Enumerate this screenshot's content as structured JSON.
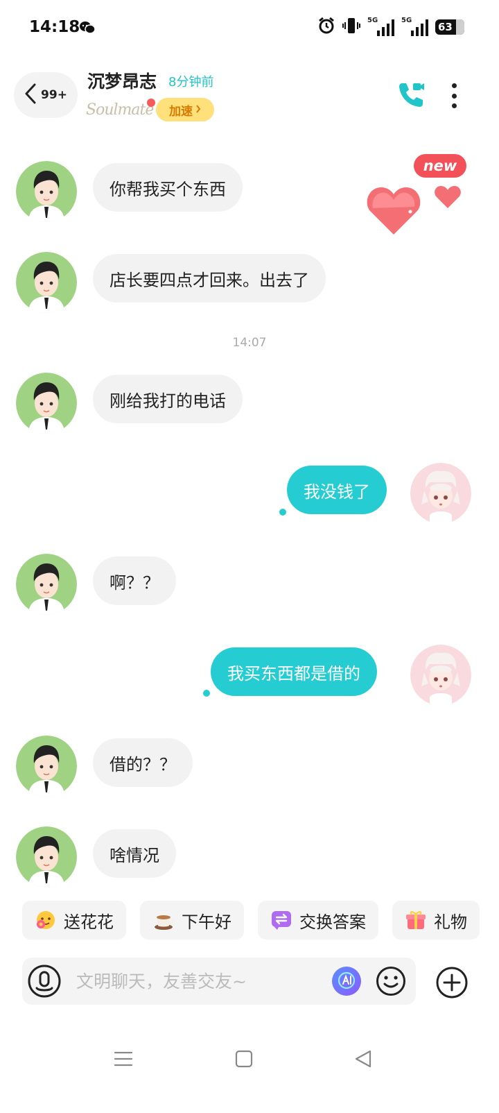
{
  "status_bar": {
    "time": "14:18",
    "battery": "63",
    "network_1": "5G",
    "network_2": "5G",
    "icons": [
      "wechat-icon",
      "alarm-icon",
      "vibrate-icon",
      "signal-icon",
      "signal-icon",
      "battery-icon"
    ]
  },
  "header": {
    "unread_count": "99+",
    "contact_name": "沉梦昂志",
    "last_seen": "8分钟前",
    "badge_text": "Soulmate",
    "boost_label": "加速",
    "accent_color": "#20c4c9"
  },
  "new_badge": "new",
  "messages": [
    {
      "side": "in",
      "text": "你帮我买个东西"
    },
    {
      "side": "in",
      "text": "店长要四点才回来。出去了"
    },
    {
      "side": "time",
      "text": "14:07"
    },
    {
      "side": "in",
      "text": "刚给我打的电话"
    },
    {
      "side": "out",
      "text": "我没钱了"
    },
    {
      "side": "in",
      "text": "啊？？"
    },
    {
      "side": "out",
      "text": "我买东西都是借的"
    },
    {
      "side": "in",
      "text": "借的？？"
    },
    {
      "side": "in",
      "text": "啥情况"
    }
  ],
  "quick_replies": [
    {
      "label": "送花花",
      "icon": "flower-emoji-icon"
    },
    {
      "label": "下午好",
      "icon": "coffee-icon"
    },
    {
      "label": "交换答案",
      "icon": "swap-icon"
    },
    {
      "label": "礼物",
      "icon": "gift-icon"
    }
  ],
  "composer": {
    "placeholder": "文明聊天，友善交友~"
  },
  "colors": {
    "outgoing_bubble": "#25cdd2",
    "incoming_bubble": "#f2f2f2",
    "boost_bg": "#ffe07a",
    "new_badge": "#f2515a"
  }
}
